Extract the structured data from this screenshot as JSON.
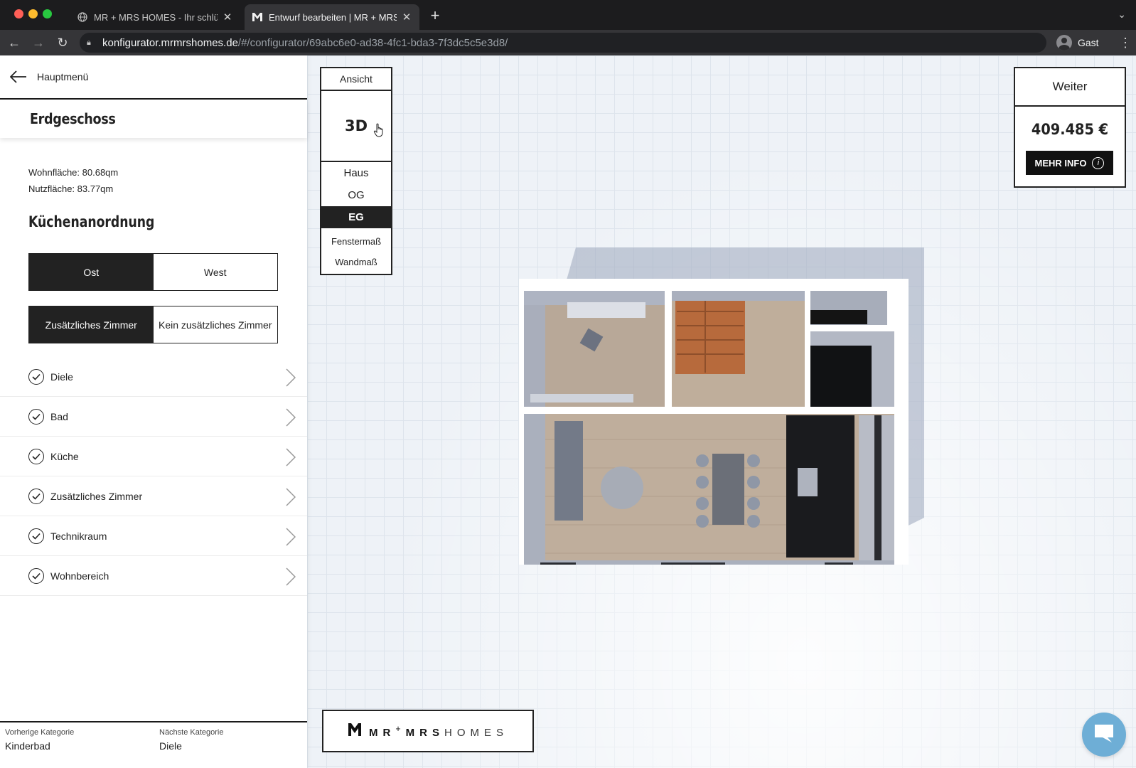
{
  "browser": {
    "tabs": [
      {
        "title": "MR + MRS HOMES - Ihr schlüs",
        "active": false
      },
      {
        "title": "Entwurf bearbeiten | MR + MRS",
        "active": true
      }
    ],
    "url_host": "konfigurator.mrmrshomes.de",
    "url_path": "/#/configurator/69abc6e0-ad38-4fc1-bda3-7f3dc5c5e3d8/",
    "profile_name": "Gast"
  },
  "sidebar": {
    "back_label": "Hauptmenü",
    "floor_title": "Erdgeschoss",
    "living_area": "Wohnfläche: 80.68qm",
    "usable_area": "Nutzfläche: 83.77qm",
    "section_title": "Küchenanordnung",
    "orientation_options": [
      "Ost",
      "West"
    ],
    "orientation_selected": "Ost",
    "room_options": [
      "Zusätzliches Zimmer",
      "Kein zusätzliches Zimmer"
    ],
    "room_selected": "Zusätzliches Zimmer",
    "categories": [
      "Diele",
      "Bad",
      "Küche",
      "Zusätzliches Zimmer",
      "Technikraum",
      "Wohnbereich"
    ],
    "footer": {
      "prev_label": "Vorherige Kategorie",
      "prev_value": "Kinderbad",
      "next_label": "Nächste Kategorie",
      "next_value": "Diele"
    }
  },
  "view": {
    "header": "Ansicht",
    "mode": "3D",
    "levels": [
      "Haus",
      "OG",
      "EG"
    ],
    "selected_level": "EG",
    "measures": [
      "Fenstermaß",
      "Wandmaß"
    ]
  },
  "pricing": {
    "next_label": "Weiter",
    "price": "409.485 €",
    "more_info_label": "MEHR INFO"
  },
  "logo": {
    "part1": "MR",
    "plus": "+",
    "part2": "MRS",
    "part3": "HOMES"
  },
  "colors": {
    "accent_dark": "#222222",
    "chat_bubble": "#6eaed6",
    "canvas_bg": "#eef2f7"
  }
}
